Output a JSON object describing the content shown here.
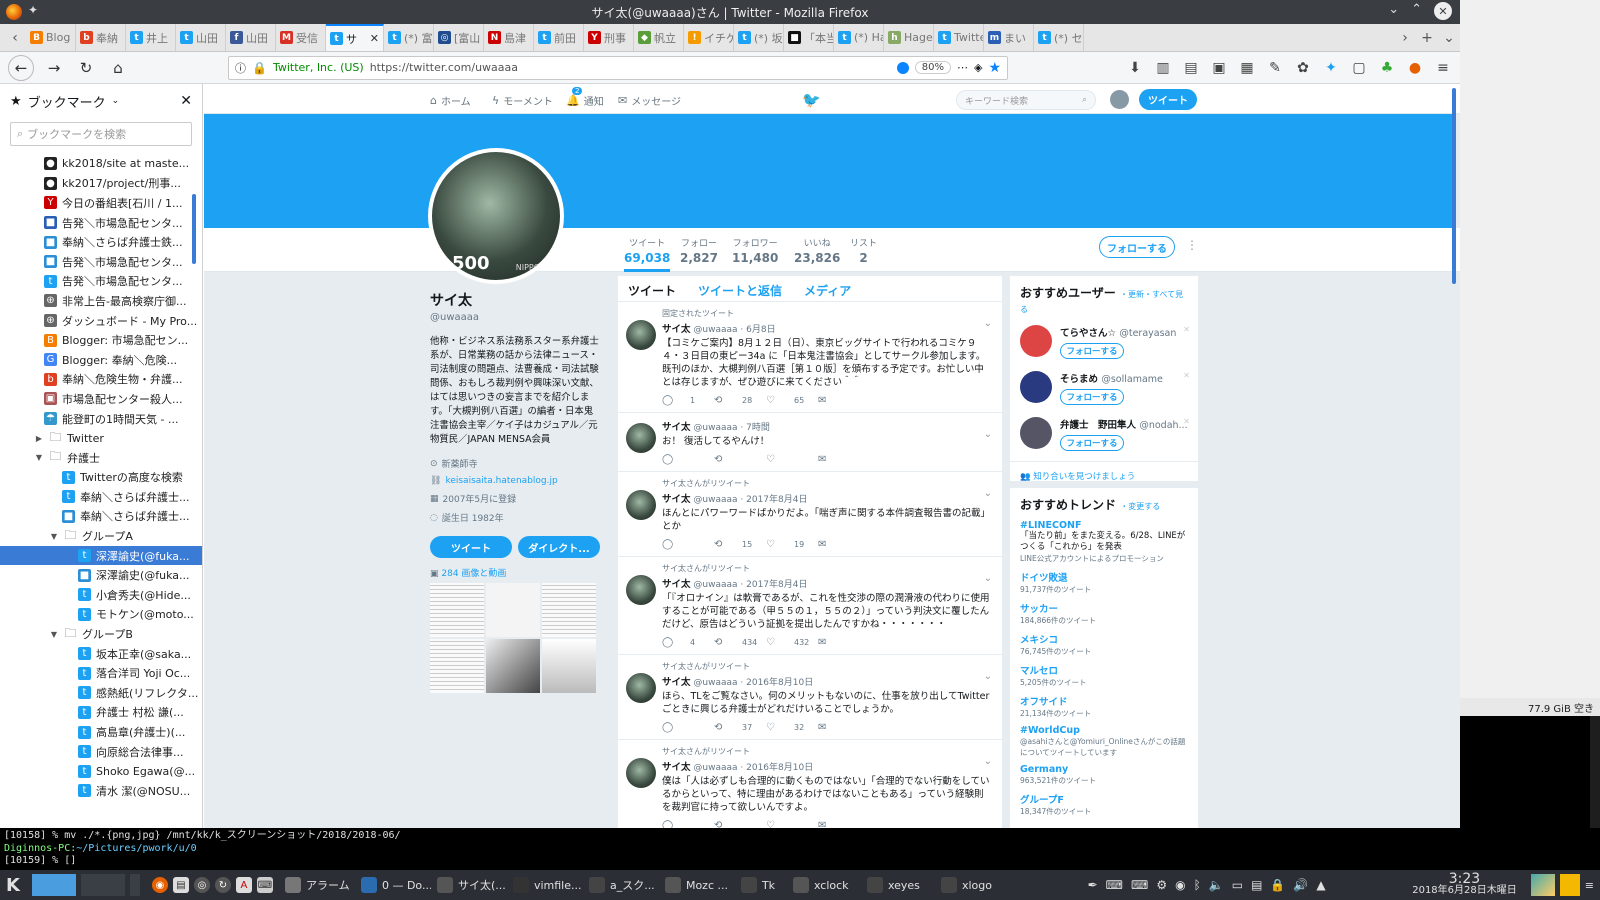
{
  "window_title": "サイ太(@uwaaaa)さん | Twitter - Mozilla Firefox",
  "tabs": [
    {
      "label": "Blog",
      "color": "#f57d00",
      "glyph": "B"
    },
    {
      "label": "奉納",
      "color": "#e04020",
      "glyph": "b"
    },
    {
      "label": "井上",
      "color": "#1da1f2",
      "glyph": "t"
    },
    {
      "label": "山田",
      "color": "#1da1f2",
      "glyph": "t"
    },
    {
      "label": "山田",
      "color": "#3b5998",
      "glyph": "f"
    },
    {
      "label": "受信",
      "color": "#d93025",
      "glyph": "M"
    },
    {
      "label": "サ",
      "color": "#1da1f2",
      "glyph": "t",
      "active": true
    },
    {
      "label": "(*) 富",
      "color": "#1da1f2",
      "glyph": "t"
    },
    {
      "label": "[富山",
      "color": "#1f4d8f",
      "glyph": "◎"
    },
    {
      "label": "島津",
      "color": "#c00",
      "glyph": "N"
    },
    {
      "label": "前田",
      "color": "#1da1f2",
      "glyph": "t"
    },
    {
      "label": "刑事",
      "color": "#c00",
      "glyph": "Y"
    },
    {
      "label": "帆立",
      "color": "#5a9e3a",
      "glyph": "◆"
    },
    {
      "label": "イチケ",
      "color": "#f59b00",
      "glyph": "!"
    },
    {
      "label": "(*) 坂",
      "color": "#1da1f2",
      "glyph": "t"
    },
    {
      "label": "「本当",
      "color": "#111",
      "glyph": "■"
    },
    {
      "label": "(*) Ha",
      "color": "#1da1f2",
      "glyph": "t"
    },
    {
      "label": "Hage",
      "color": "#8a6",
      "glyph": "h"
    },
    {
      "label": "Twitte",
      "color": "#1da1f2",
      "glyph": "t"
    },
    {
      "label": "まい",
      "color": "#2b5fb5",
      "glyph": "m"
    },
    {
      "label": "(*) セ",
      "color": "#1da1f2",
      "glyph": "t"
    }
  ],
  "toolbar": {
    "org": "Twitter, Inc. (US)",
    "url": "https://twitter.com/uwaaaa",
    "zoom": "80%"
  },
  "sidebar": {
    "title": "ブックマーク",
    "search_placeholder": "ブックマークを検索",
    "items": [
      {
        "label": "kk2018/site at maste...",
        "icon": "github-icon",
        "color": "#222",
        "glyph": "●",
        "indent": 0
      },
      {
        "label": "kk2017/project/刑事...",
        "icon": "github-icon",
        "color": "#222",
        "glyph": "●",
        "indent": 0
      },
      {
        "label": "今日の番組表[石川 / 1...",
        "icon": "yahoo-icon",
        "color": "#c00",
        "glyph": "Y",
        "indent": 0
      },
      {
        "label": "告発＼市場急配センタ...",
        "icon": "hatena-icon",
        "color": "#2b5fb5",
        "glyph": "■",
        "indent": 0
      },
      {
        "label": "奉納＼さらば弁護士鉄...",
        "icon": "hatena-icon",
        "color": "#2b8fd5",
        "glyph": "■",
        "indent": 0
      },
      {
        "label": "告発＼市場急配センタ...",
        "icon": "hatena-icon",
        "color": "#2b8fd5",
        "glyph": "■",
        "indent": 0
      },
      {
        "label": "告発＼市場急配センタ...",
        "icon": "twitter-icon",
        "color": "#1da1f2",
        "glyph": "t",
        "indent": 0
      },
      {
        "label": "非常上告-最高検察庁御...",
        "icon": "globe-icon",
        "color": "#666",
        "glyph": "⊕",
        "indent": 0
      },
      {
        "label": "ダッシュボード - My Pro...",
        "icon": "globe-icon",
        "color": "#666",
        "glyph": "⊕",
        "indent": 0
      },
      {
        "label": "Blogger: 市場急配セン...",
        "icon": "blogger-icon",
        "color": "#f57d00",
        "glyph": "B",
        "indent": 0
      },
      {
        "label": "Blogger: 奉納＼危険...",
        "icon": "google-icon",
        "color": "#4285f4",
        "glyph": "G",
        "indent": 0
      },
      {
        "label": "奉納＼危険生物・弁護...",
        "icon": "blog-icon",
        "color": "#e04020",
        "glyph": "b",
        "indent": 0
      },
      {
        "label": "市場急配センター殺人...",
        "icon": "image-icon",
        "color": "#a55",
        "glyph": "▣",
        "indent": 0
      },
      {
        "label": "能登町の1時間天気 - ...",
        "icon": "weather-icon",
        "color": "#39c",
        "glyph": "☂",
        "indent": 0
      },
      {
        "label": "Twitter",
        "icon": "folder-icon",
        "folder": true,
        "open": false,
        "indent": 1
      },
      {
        "label": "弁護士",
        "icon": "folder-icon",
        "folder": true,
        "open": true,
        "indent": 1
      },
      {
        "label": "Twitterの高度な検索",
        "icon": "twitter-icon",
        "color": "#1da1f2",
        "glyph": "t",
        "indent": 2
      },
      {
        "label": "奉納＼さらば弁護士...",
        "icon": "twitter-icon",
        "color": "#1da1f2",
        "glyph": "t",
        "indent": 2
      },
      {
        "label": "奉納＼さらば弁護士...",
        "icon": "hatena-icon",
        "color": "#2b8fd5",
        "glyph": "■",
        "indent": 2
      },
      {
        "label": "グループA",
        "icon": "folder-icon",
        "folder": true,
        "open": true,
        "indent": 2
      },
      {
        "label": "深澤諭史(@fuka...",
        "icon": "twitter-icon",
        "color": "#1da1f2",
        "glyph": "t",
        "indent": 3,
        "selected": true
      },
      {
        "label": "深澤諭史(@fuka...",
        "icon": "hatena-icon",
        "color": "#2b8fd5",
        "glyph": "■",
        "indent": 3
      },
      {
        "label": "小倉秀夫(@Hide...",
        "icon": "twitter-icon",
        "color": "#1da1f2",
        "glyph": "t",
        "indent": 3
      },
      {
        "label": "モトケン(@moto...",
        "icon": "twitter-icon",
        "color": "#1da1f2",
        "glyph": "t",
        "indent": 3
      },
      {
        "label": "グループB",
        "icon": "folder-icon",
        "folder": true,
        "open": true,
        "indent": 2
      },
      {
        "label": "坂本正幸(@saka...",
        "icon": "twitter-icon",
        "color": "#1da1f2",
        "glyph": "t",
        "indent": 3
      },
      {
        "label": "落合洋司 Yoji Oc...",
        "icon": "twitter-icon",
        "color": "#1da1f2",
        "glyph": "t",
        "indent": 3
      },
      {
        "label": "感熱紙(リフレクタ...",
        "icon": "twitter-icon",
        "color": "#1da1f2",
        "glyph": "t",
        "indent": 3
      },
      {
        "label": "弁護士 村松 謙(...",
        "icon": "twitter-icon",
        "color": "#1da1f2",
        "glyph": "t",
        "indent": 3
      },
      {
        "label": "高島章(弁護士)(...",
        "icon": "twitter-icon",
        "color": "#1da1f2",
        "glyph": "t",
        "indent": 3
      },
      {
        "label": "向原総合法律事...",
        "icon": "twitter-icon",
        "color": "#1da1f2",
        "glyph": "t",
        "indent": 3
      },
      {
        "label": "Shoko Egawa(@...",
        "icon": "twitter-icon",
        "color": "#1da1f2",
        "glyph": "t",
        "indent": 3
      },
      {
        "label": "清水 潔(@NOSU...",
        "icon": "twitter-icon",
        "color": "#1da1f2",
        "glyph": "t",
        "indent": 3
      }
    ]
  },
  "twitter_nav": {
    "home": "ホーム",
    "moments": "モーメント",
    "notifications": "通知",
    "notif_badge": "2",
    "messages": "メッセージ",
    "search_placeholder": "キーワード検索",
    "tweet_button": "ツイート"
  },
  "profile": {
    "stamp_value": "500",
    "stamp_text": "NIPPON",
    "name": "サイ太",
    "handle": "@uwaaaa",
    "bio": "他称・ビジネス系法務系スター系弁護士系が、日常業務の話から法律ニュース・司法制度の問題点、法曹養成・司法試験問係、おもしろ裁判例や興味深い文献、はては思いつきの妄言までを紹介します。「大槻判例八百選」の編者・日本鬼注書協会主宰／ケイ子はカジュアル／元物質民／JAPAN MENSA会員",
    "location": "新薬師寺",
    "website": "keisaisaita.hatenablog.jp",
    "joined": "2007年5月に登録",
    "birthday": "誕生日 1982年",
    "tweet_btn": "ツイート",
    "dm_btn": "ダイレクト...",
    "media_link": "284 画像と動画",
    "follow_btn": "フォローする"
  },
  "stats": [
    {
      "label": "ツイート",
      "value": "69,038",
      "active": true
    },
    {
      "label": "フォロー",
      "value": "2,827"
    },
    {
      "label": "フォロワー",
      "value": "11,480"
    },
    {
      "label": "いいね",
      "value": "23,826"
    },
    {
      "label": "リスト",
      "value": "2"
    }
  ],
  "timeline_tabs": [
    "ツイート",
    "ツイートと返信",
    "メディア"
  ],
  "tweets": [
    {
      "context": "固定されたツイート",
      "name": "サイ太",
      "handle": "@uwaaaa",
      "date": "6月8日",
      "text": "【コミケご案内】8月１２日（日）、東京ビッグサイトで行われるコミケ９４・３日目の東ピー34a に「日本鬼注書協会」としてサークル参加します。既刊のほか、大槻判例八百選［第１０版］を頒布する予定です。お忙しい中とは存じますが、ぜひ遊びに来てください＾＾",
      "reply": "1",
      "rt": "28",
      "like": "65"
    },
    {
      "context": "",
      "name": "サイ太",
      "handle": "@uwaaaa",
      "date": "7時間",
      "text": "お！ 復活してるやんけ！",
      "reply": "",
      "rt": "",
      "like": ""
    },
    {
      "context": "サイ太さんがリツイート",
      "name": "サイ太",
      "handle": "@uwaaaa",
      "date": "2017年8月4日",
      "text": "ほんとにパワーワードばかりだよ。「喘ぎ声に関する本件調査報告書の記載」とか",
      "reply": "",
      "rt": "15",
      "like": "19"
    },
    {
      "context": "サイ太さんがリツイート",
      "name": "サイ太",
      "handle": "@uwaaaa",
      "date": "2017年8月4日",
      "text": "「『オロナイン』は軟膏であるが、これを性交渉の際の潤滑液の代わりに使用することが可能である（甲５５の１，５５の２）」っていう判決文に覆したんだけど、原告はどういう証拠を提出したんですかね・・・・・・・",
      "reply": "4",
      "rt": "434",
      "like": "432"
    },
    {
      "context": "サイ太さんがリツイート",
      "name": "サイ太",
      "handle": "@uwaaaa",
      "date": "2016年8月10日",
      "text": "ほら、TLをご覧なさい。何のメリットもないのに、仕事を放り出してTwitterごときに興じる弁護士がどれだけいることでしょうか。",
      "reply": "",
      "rt": "37",
      "like": "32"
    },
    {
      "context": "サイ太さんがリツイート",
      "name": "サイ太",
      "handle": "@uwaaaa",
      "date": "2016年8月10日",
      "text": "僕は「人は必ずしも合理的に動くものではない」「合理的でない行動をしているからといって、特に理由があるわけではないこともある」っていう経験則を裁判官に持って欲しいんですよ。",
      "reply": "",
      "rt": "",
      "like": ""
    }
  ],
  "who_to_follow": {
    "title": "おすすめユーザー",
    "links": "・更新・すべて見る",
    "users": [
      {
        "name": "てらやさん☆",
        "handle": "@terayasan",
        "color": "#d44"
      },
      {
        "name": "そらまめ",
        "handle": "@sollamame",
        "color": "#2a3a80"
      },
      {
        "name": "弁護士　野田隼人",
        "handle": "@nodah...",
        "color": "#556"
      }
    ],
    "follow_label": "フォローする",
    "find_friends": "知り合いを見つけましょう"
  },
  "trends": {
    "title": "おすすめトレンド",
    "change": "・変更する",
    "items": [
      {
        "name": "#LINECONF",
        "desc": "「当たり前」をまた変える。6/28、LINEがつくる「これから」を発表",
        "count": "LINE公式アカウントによるプロモーション"
      },
      {
        "name": "ドイツ敗退",
        "desc": "",
        "count": "91,737件のツイート"
      },
      {
        "name": "サッカー",
        "desc": "",
        "count": "184,866件のツイート"
      },
      {
        "name": "メキシコ",
        "desc": "",
        "count": "76,745件のツイート"
      },
      {
        "name": "マルセロ",
        "desc": "",
        "count": "5,205件のツイート"
      },
      {
        "name": "オフサイド",
        "desc": "",
        "count": "21,134件のツイート"
      },
      {
        "name": "#WorldCup",
        "desc": "",
        "count": "@asahiさんと@Yomiuri_Onlineさんがこの話題についてツイートしています"
      },
      {
        "name": "Germany",
        "desc": "",
        "count": "963,521件のツイート"
      },
      {
        "name": "グループF",
        "desc": "",
        "count": "18,347件のツイート"
      }
    ]
  },
  "desktop": {
    "disk_free": "77.9 GiB 空き"
  },
  "terminal": {
    "line1": "[10158]  % mv ./*.{png,jpg} /mnt/kk/k_スクリーンショット/2018/2018-06/",
    "line2_host": "Diginnos-PC:",
    "line2_path": "~/Pictures/pwork/u/0",
    "line3": "[10159]  % []"
  },
  "taskbar": {
    "items": [
      "アラーム",
      "0 — Do...",
      "サイ太(...",
      "vimfile...",
      "a_スク...",
      "Mozc ...",
      "Tk",
      "xclock",
      "xeyes",
      "xlogo"
    ],
    "time": "3:23",
    "date": "2018年6月28日木曜日"
  }
}
